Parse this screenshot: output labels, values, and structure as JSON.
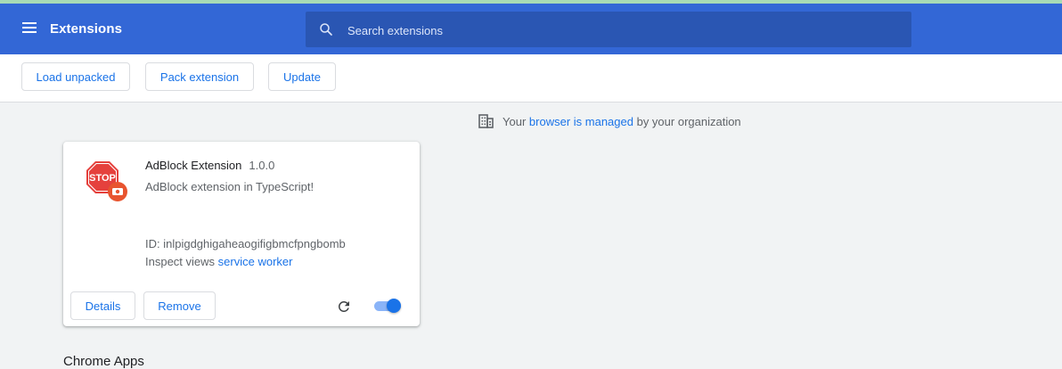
{
  "header": {
    "title": "Extensions",
    "menu_icon": "hamburger-menu-icon",
    "search_placeholder": "Search extensions",
    "search_value": "",
    "brand_color": "#3367d6"
  },
  "toolbar": {
    "load_unpacked_label": "Load unpacked",
    "pack_extension_label": "Pack extension",
    "update_label": "Update"
  },
  "managed_notice": {
    "prefix": "Your",
    "link": "browser is managed",
    "suffix": "by your organization",
    "icon": "building-icon"
  },
  "extension": {
    "name": "AdBlock Extension",
    "version": "1.0.0",
    "description": "AdBlock extension in TypeScript!",
    "id_text": "ID: inlpigdghigaheaogifigbmcfpngbomb",
    "inspect_label": "Inspect views",
    "inspect_link": "service worker",
    "icon": "stop-sign-icon",
    "details_label": "Details",
    "remove_label": "Remove",
    "enabled": true
  },
  "sections": {
    "chrome_apps": "Chrome Apps"
  }
}
